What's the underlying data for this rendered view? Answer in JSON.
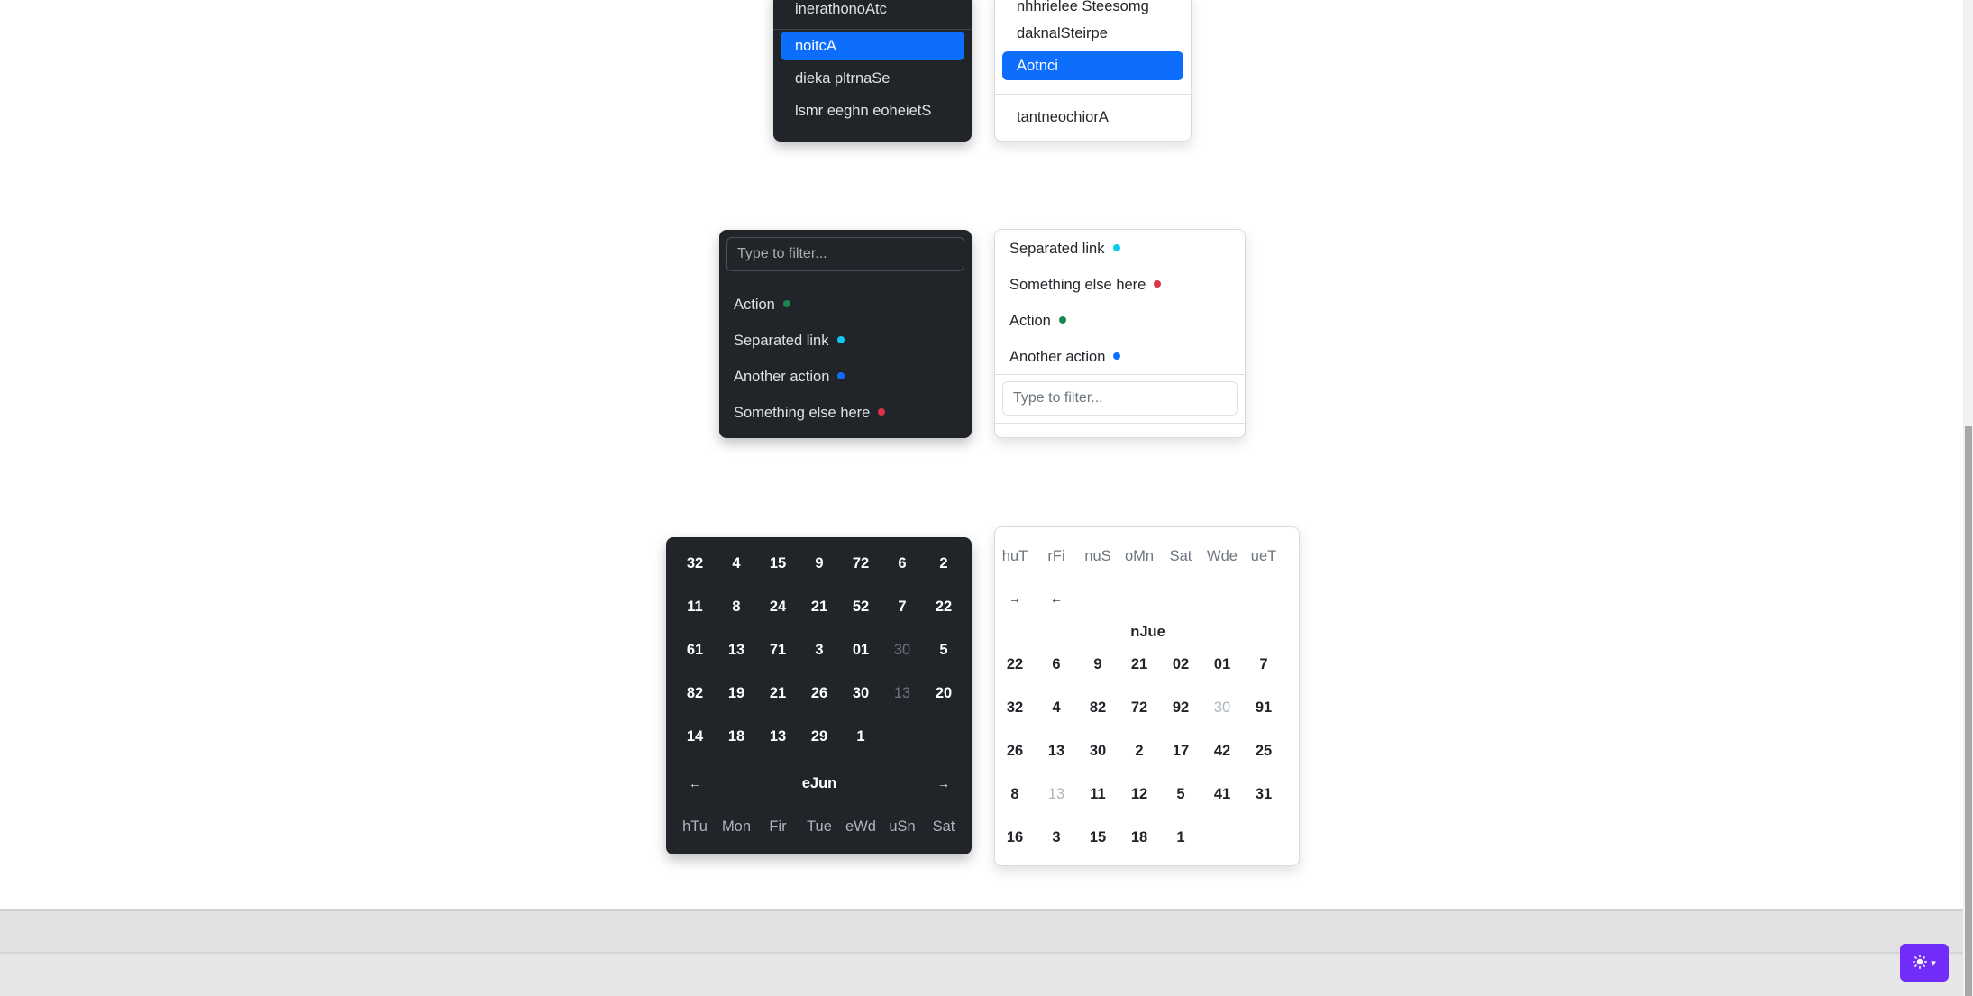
{
  "menu1": {
    "top_item": "inerathonoAtc",
    "items": [
      "noitcA",
      "dieka pltrnaSe",
      "lsmr eeghn eoheietS"
    ],
    "active_index": 0
  },
  "menu2": {
    "top_item": "nhhrielee Steesomg",
    "items": [
      "daknalSteirpe",
      "Aotnci"
    ],
    "active_index": 1,
    "after_divider": "tantneochiorA"
  },
  "filter_dark": {
    "placeholder": "Type to filter...",
    "items": [
      {
        "label": "Action",
        "color": "#198754"
      },
      {
        "label": "Separated link",
        "color": "#0dcaf0"
      },
      {
        "label": "Another action",
        "color": "#0d6efd"
      },
      {
        "label": "Something else here",
        "color": "#dc3545"
      }
    ]
  },
  "filter_light": {
    "placeholder": "Type to filter...",
    "items": [
      {
        "label": "Separated link",
        "color": "#0dcaf0"
      },
      {
        "label": "Something else here",
        "color": "#dc3545"
      },
      {
        "label": "Action",
        "color": "#198754"
      },
      {
        "label": "Another action",
        "color": "#0d6efd"
      }
    ]
  },
  "cal_dark": {
    "rows": [
      [
        "32",
        "4",
        "15",
        "9",
        "72",
        "6",
        "2"
      ],
      [
        "11",
        "8",
        "24",
        "21",
        "52",
        "7",
        "22"
      ],
      [
        "61",
        "13",
        "71",
        "3",
        "01",
        "30",
        "5"
      ],
      [
        "82",
        "19",
        "21",
        "26",
        "30",
        "13",
        "20"
      ],
      [
        "14",
        "18",
        "13",
        "29",
        "1",
        "",
        ""
      ]
    ],
    "muted": [
      [
        2,
        5
      ],
      [
        3,
        5
      ]
    ],
    "month": "eJun",
    "prev_arrow": "←",
    "next_arrow": "→",
    "weekdays": [
      "hTu",
      "Mon",
      "Fir",
      "Tue",
      "eWd",
      "uSn",
      "Sat"
    ]
  },
  "cal_light": {
    "weekdays": [
      "huT",
      "rFi",
      "nuS",
      "oMn",
      "Sat",
      "Wde",
      "ueT"
    ],
    "next_arrow": "→",
    "prev_arrow": "←",
    "month": "nJue",
    "rows": [
      [
        "22",
        "6",
        "9",
        "21",
        "02",
        "01",
        "7"
      ],
      [
        "32",
        "4",
        "82",
        "72",
        "92",
        "30",
        "91"
      ],
      [
        "26",
        "13",
        "30",
        "2",
        "17",
        "42",
        "25"
      ],
      [
        "8",
        "13",
        "11",
        "12",
        "5",
        "41",
        "31"
      ],
      [
        "16",
        "3",
        "15",
        "18",
        "1",
        "",
        ""
      ]
    ],
    "muted": [
      [
        1,
        5
      ],
      [
        3,
        1
      ]
    ]
  },
  "theme_toggle": {
    "icon": "sun-icon",
    "caret": "▾",
    "color": "#712cf9"
  }
}
